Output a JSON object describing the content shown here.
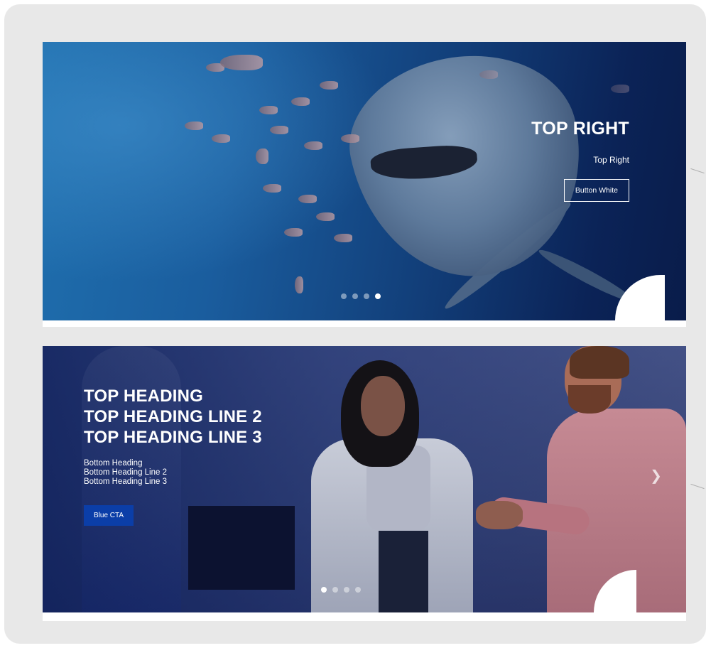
{
  "slides": [
    {
      "heading": "TOP RIGHT",
      "subheading": "Top Right",
      "button_label": "Button White",
      "dots_total": 4,
      "active_dot": 4
    },
    {
      "top_heading_lines": [
        "TOP HEADING",
        "TOP HEADING LINE 2",
        "TOP HEADING LINE 3"
      ],
      "bottom_heading_lines": [
        "Bottom Heading",
        "Bottom Heading Line 2",
        "Bottom Heading Line 3"
      ],
      "button_label": "Blue CTA",
      "dots_total": 4,
      "active_dot": 1
    }
  ],
  "icons": {
    "next_arrow": "chevron-right-icon"
  },
  "colors": {
    "card_background": "#e8e8e8",
    "cta_blue": "#0b3ea8",
    "text_white": "#ffffff"
  }
}
